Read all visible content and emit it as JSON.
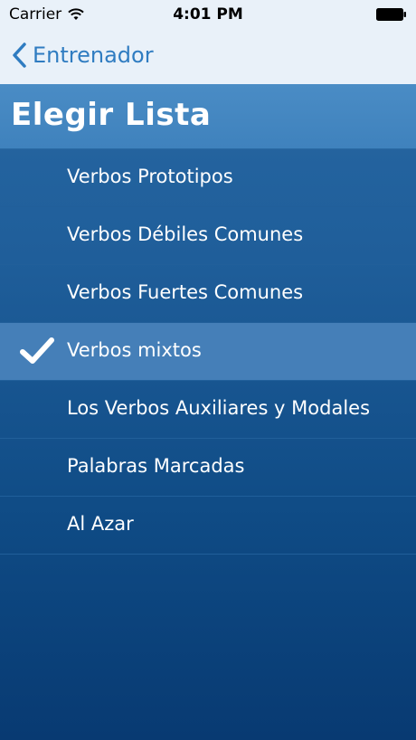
{
  "status_bar": {
    "carrier": "Carrier",
    "time": "4:01 PM"
  },
  "nav": {
    "back_label": "Entrenador"
  },
  "header": {
    "title": "Elegir Lista"
  },
  "list": {
    "items": [
      {
        "label": "Verbos Prototipos",
        "selected": false
      },
      {
        "label": "Verbos Débiles Comunes",
        "selected": false
      },
      {
        "label": "Verbos Fuertes Comunes",
        "selected": false
      },
      {
        "label": "Verbos mixtos",
        "selected": true
      },
      {
        "label": "Los Verbos Auxiliares y Modales",
        "selected": false
      },
      {
        "label": "Palabras Marcadas",
        "selected": false
      },
      {
        "label": "Al Azar",
        "selected": false
      }
    ]
  },
  "colors": {
    "nav_background": "#e9f1f9",
    "accent": "#2f7cc1",
    "header_background": "#4a8cc5",
    "selected_row": "#457fb8",
    "list_background": "#1f5e9a"
  },
  "icons": {
    "back": "chevron-left-icon",
    "wifi": "wifi-icon",
    "battery": "battery-icon",
    "selected_mark": "checkmark-icon"
  }
}
